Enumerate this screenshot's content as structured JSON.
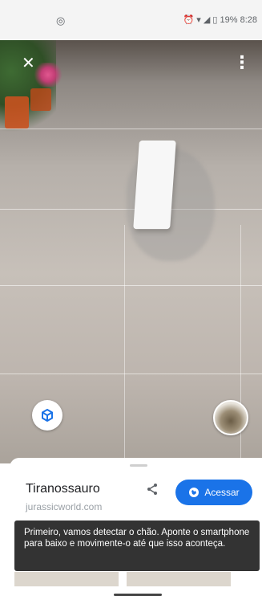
{
  "status_bar": {
    "left_icon": "instagram-icon",
    "alarm_icon": "alarm-icon",
    "wifi_icon": "wifi-icon",
    "signal_icon": "signal-icon",
    "battery_icon": "battery-icon",
    "battery": "19%",
    "time": "8:28"
  },
  "ar_view": {
    "close_icon": "close-icon",
    "menu_icon": "more-vert-icon",
    "cube_icon": "3d-cube-icon",
    "thumbnail": "dinosaur-thumbnail"
  },
  "sheet": {
    "title": "Tiranossauro",
    "domain": "jurassicworld.com",
    "share_icon": "share-icon",
    "visit_label": "Acessar",
    "visit_icon": "globe-icon"
  },
  "toast": {
    "message": "Primeiro, vamos detectar o chão. Aponte o smartphone para baixo e movimente-o até que isso aconteça."
  },
  "colors": {
    "accent": "#1a73e8",
    "toast_bg": "#333333"
  }
}
